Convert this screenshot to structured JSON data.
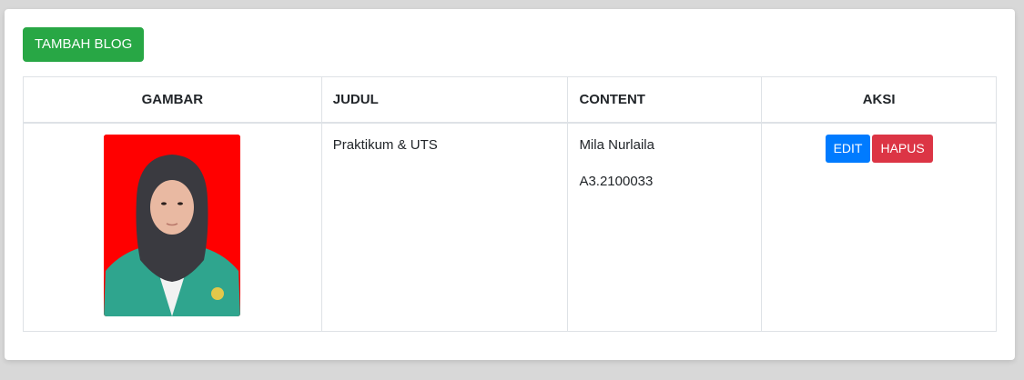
{
  "toolbar": {
    "add_label": "TAMBAH BLOG"
  },
  "table": {
    "headers": [
      "GAMBAR",
      "JUDUL",
      "CONTENT",
      "AKSI"
    ],
    "rows": [
      {
        "image_icon": "portrait-photo",
        "judul": "Praktikum & UTS",
        "content": [
          "Mila Nurlaila",
          "A3.2100033"
        ],
        "edit_label": "EDIT",
        "delete_label": "HAPUS"
      }
    ]
  },
  "colors": {
    "add_button": "#28a745",
    "edit_button": "#007bff",
    "delete_button": "#dc3545",
    "photo_background": "#ff0000"
  }
}
